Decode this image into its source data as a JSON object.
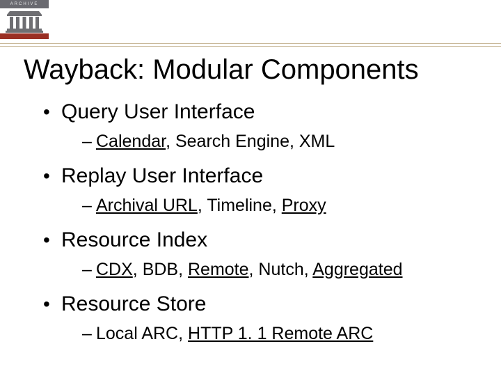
{
  "logo": {
    "top_label": "ARCHIVE"
  },
  "title": "Wayback: Modular Components",
  "bullets": [
    {
      "label": "Query User Interface",
      "sub": [
        [
          {
            "t": "Calendar",
            "u": true
          },
          {
            "t": ", Search Engine, XML",
            "u": false
          }
        ]
      ]
    },
    {
      "label": "Replay User Interface",
      "sub": [
        [
          {
            "t": "Archival URL",
            "u": true
          },
          {
            "t": ", Timeline, ",
            "u": false
          },
          {
            "t": "Proxy",
            "u": true
          }
        ]
      ]
    },
    {
      "label": "Resource Index",
      "sub": [
        [
          {
            "t": "CDX",
            "u": true
          },
          {
            "t": ", BDB, ",
            "u": false
          },
          {
            "t": "Remote",
            "u": true
          },
          {
            "t": ", Nutch, ",
            "u": false
          },
          {
            "t": "Aggregated",
            "u": true
          }
        ]
      ]
    },
    {
      "label": "Resource Store",
      "sub": [
        [
          {
            "t": "Local ARC, ",
            "u": false
          },
          {
            "t": "HTTP 1. 1 Remote ARC",
            "u": true
          }
        ]
      ]
    }
  ]
}
